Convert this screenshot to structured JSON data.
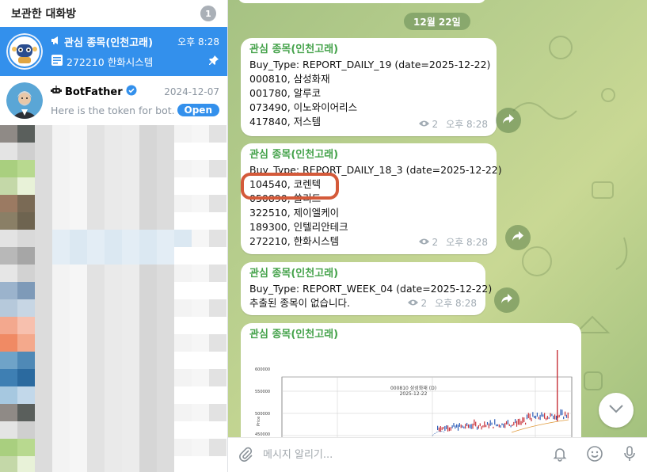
{
  "sidebar": {
    "title": "보관한 대화방",
    "count": "1",
    "chats": [
      {
        "name": "관심 종목(인천고래)",
        "time": "오후 8:28",
        "preview": "272210 한화시스템"
      },
      {
        "name": "BotFather",
        "time": "2024-12-07",
        "preview": "Here is the token for bot...",
        "action": "Open"
      }
    ]
  },
  "main": {
    "date_pill": "12월 22일",
    "messages": [
      {
        "sender": "관심 종목(인천고래)",
        "lines": [
          "Buy_Type: REPORT_DAILY_19 (date=2025-12-22)",
          "000810, 삼성화재",
          "001780, 알루코",
          "073490, 이노와이어리스",
          "417840, 저스템"
        ],
        "views": "2",
        "time": "오후 8:28"
      },
      {
        "sender": "관심 종목(인천고래)",
        "lines": [
          "Buy_Type: REPORT_DAILY_18_3 (date=2025-12-22)",
          "104540, 코렌텍",
          "050890, 쏠리드",
          "322510, 제이엘케이",
          "189300, 인텔리안테크",
          "272210, 한화시스템"
        ],
        "views": "2",
        "time": "오후 8:28"
      },
      {
        "sender": "관심 종목(인천고래)",
        "lines": [
          "Buy_Type: REPORT_WEEK_04 (date=2025-12-22)",
          "추출된 종목이 없습니다."
        ],
        "views": "2",
        "time": "오후 8:28"
      },
      {
        "sender": "관심 종목(인천고래)",
        "chart_title": "000810 삼성화재 (D)",
        "chart_date": "2025-12-22",
        "y_ticks": [
          "600000",
          "550000",
          "500000",
          "450000"
        ],
        "y_label": "Price"
      }
    ]
  },
  "composer": {
    "placeholder": "메시지 알리기..."
  },
  "colors": {
    "accent": "#3390ec",
    "sender": "#44a24a",
    "highlight": "#d45a3a"
  },
  "icons": [
    "megaphone-icon",
    "document-icon",
    "pin-icon",
    "bot-icon",
    "verified-icon",
    "eye-icon",
    "forward-icon",
    "chevron-down-icon",
    "paperclip-icon",
    "bell-icon",
    "emoji-icon",
    "microphone-icon"
  ]
}
